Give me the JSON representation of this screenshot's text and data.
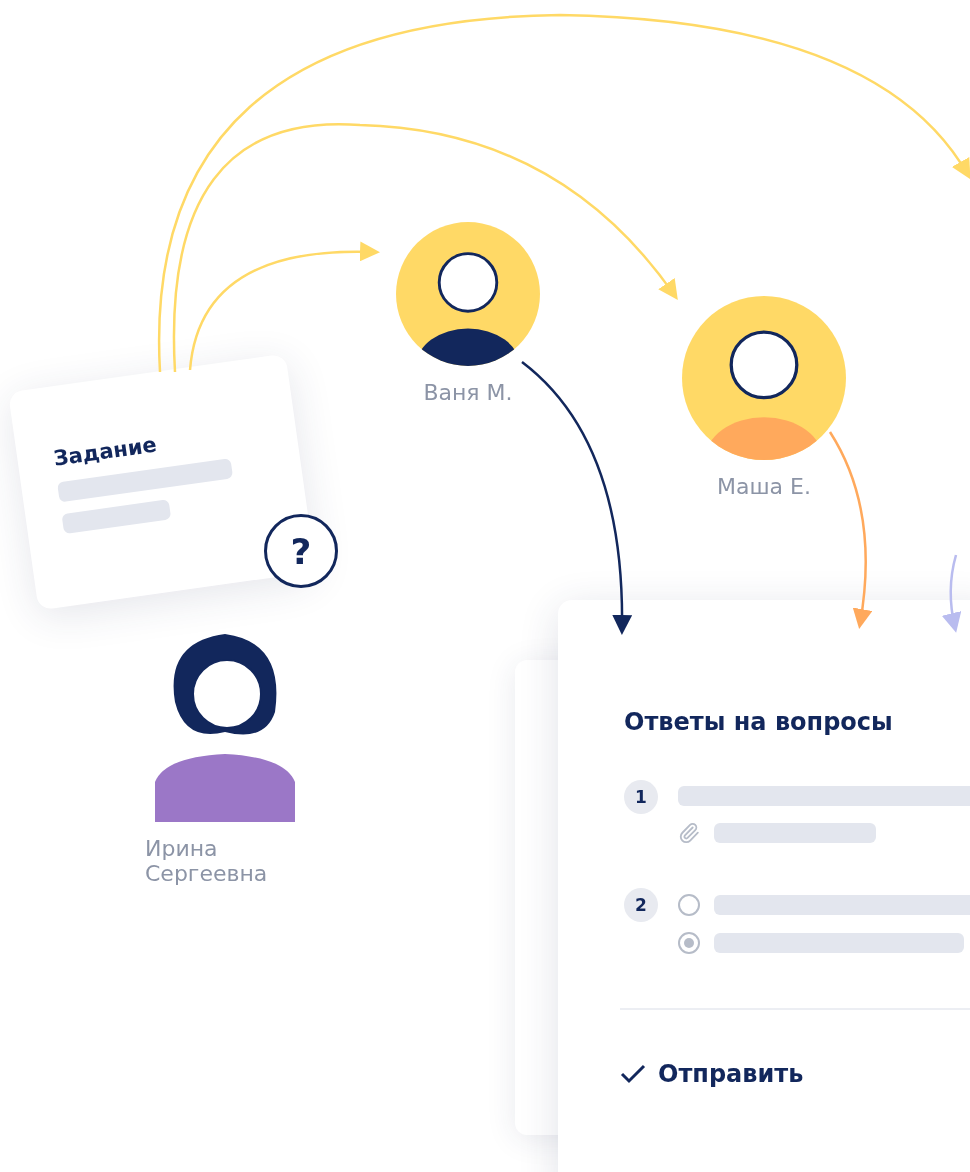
{
  "task_card": {
    "title": "Задание"
  },
  "people": [
    {
      "name": "Ваня М.",
      "kind": "avatar"
    },
    {
      "name": "Маша Е.",
      "kind": "avatar"
    },
    {
      "name": "Ирина Сергеевна",
      "kind": "teacher"
    }
  ],
  "question_bubble": {
    "mark": "?"
  },
  "answers_card": {
    "title": "Ответы на вопросы",
    "questions": [
      {
        "number": "1",
        "kind": "attachment"
      },
      {
        "number": "2",
        "kind": "choice",
        "options": [
          {
            "selected": false
          },
          {
            "selected": true
          }
        ]
      }
    ],
    "submit": {
      "label": "Отправить"
    }
  }
}
